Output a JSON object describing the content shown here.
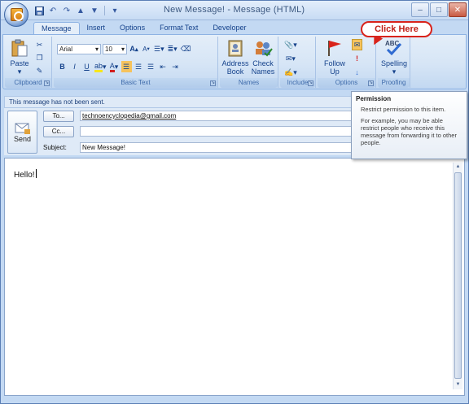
{
  "window": {
    "title": "New Message! - Message (HTML)"
  },
  "quick_access": {
    "items": [
      "save-icon",
      "undo-icon",
      "redo-icon",
      "up-icon",
      "down-icon",
      "customize-icon"
    ]
  },
  "tabs": [
    {
      "label": "Message",
      "active": true
    },
    {
      "label": "Insert"
    },
    {
      "label": "Options"
    },
    {
      "label": "Format Text"
    },
    {
      "label": "Developer"
    }
  ],
  "ribbon": {
    "clipboard": {
      "label": "Clipboard",
      "paste_label": "Paste"
    },
    "basic_text": {
      "label": "Basic Text",
      "font": "Arial",
      "size": "10"
    },
    "names": {
      "label": "Names",
      "address_book": "Address Book",
      "check_names": "Check Names"
    },
    "include": {
      "label": "Include"
    },
    "options": {
      "label": "Options",
      "follow_up": "Follow Up"
    },
    "proofing": {
      "label": "Proofing",
      "spelling": "Spelling"
    }
  },
  "callout": {
    "text": "Click Here"
  },
  "infobar": {
    "text": "This message has not been sent."
  },
  "header": {
    "send_label": "Send",
    "to_button": "To...",
    "cc_button": "Cc...",
    "subject_label": "Subject:",
    "to_value": "technoencyclopedia@gmail.com",
    "cc_value": "",
    "subject_value": "New Message!"
  },
  "body": {
    "text": "Hello!"
  },
  "tooltip": {
    "title": "Permission",
    "line1": "Restrict permission to this item.",
    "line2": "For example, you may be able restrict people who receive this message from forwarding it to other people."
  },
  "colors": {
    "ribbon": "#d6e5f6",
    "accent": "#15428b",
    "callout": "#d9231b"
  }
}
